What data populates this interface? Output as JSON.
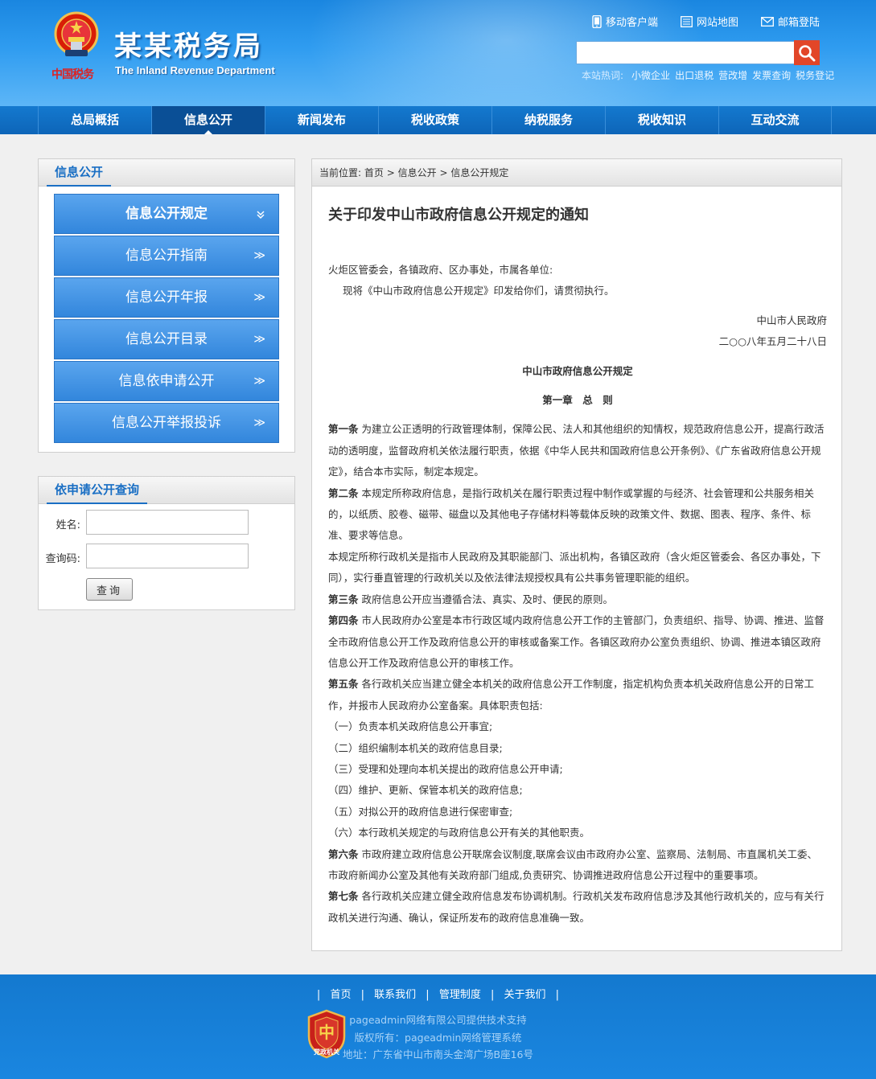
{
  "header": {
    "emblem_text": "中国税务",
    "title": "某某税务局",
    "subtitle": "The Inland Revenue Department",
    "top_links": [
      {
        "icon": "mobile-icon",
        "label": "移动客户端"
      },
      {
        "icon": "sitemap-icon",
        "label": "网站地图"
      },
      {
        "icon": "mail-icon",
        "label": "邮箱登陆"
      }
    ],
    "search": {
      "placeholder": "",
      "value": ""
    },
    "hot_label": "本站热词:",
    "hot_words": [
      "小微企业",
      "出口退税",
      "营改增",
      "发票查询",
      "税务登记"
    ]
  },
  "nav": {
    "items": [
      "总局概括",
      "信息公开",
      "新闻发布",
      "税收政策",
      "纳税服务",
      "税收知识",
      "互动交流"
    ],
    "active": 1
  },
  "sidebar": {
    "menu_title": "信息公开",
    "menu_items": [
      {
        "label": "信息公开规定",
        "chev": "≫",
        "active": true
      },
      {
        "label": "信息公开指南",
        "chev": "≫"
      },
      {
        "label": "信息公开年报",
        "chev": "≫"
      },
      {
        "label": "信息公开目录",
        "chev": "≫"
      },
      {
        "label": "信息依申请公开",
        "chev": "≫"
      },
      {
        "label": "信息公开举报投诉",
        "chev": "≫"
      }
    ],
    "query_title": "依申请公开查询",
    "name_label": "姓名:",
    "code_label": "查询码:",
    "query_button": "查询"
  },
  "main": {
    "crumb_label": "当前位置:",
    "crumbs": [
      "首页",
      "信息公开",
      "信息公开规定"
    ],
    "crumb_sep": ">",
    "title": "关于印发中山市政府信息公开规定的通知",
    "addressee": "火炬区管委会，各镇政府、区办事处，市属各单位:",
    "intro": "现将《中山市政府信息公开规定》印发给你们，请贯彻执行。",
    "signer": "中山市人民政府",
    "date": "二○○八年五月二十八日",
    "doc_title": "中山市政府信息公开规定",
    "chapter": "第一章　总　则",
    "articles": [
      {
        "head": "第一条",
        "text": "为建立公正透明的行政管理体制，保障公民、法人和其他组织的知情权，规范政府信息公开，提高行政活动的透明度，监督政府机关依法履行职责，依据《中华人民共和国政府信息公开条例》、《广东省政府信息公开规定》，结合本市实际，制定本规定。"
      },
      {
        "head": "第二条",
        "text": "本规定所称政府信息，是指行政机关在履行职责过程中制作或掌握的与经济、社会管理和公共服务相关的，以纸质、胶卷、磁带、磁盘以及其他电子存储材料等载体反映的政策文件、数据、图表、程序、条件、标准、要求等信息。"
      },
      {
        "head": "",
        "text": "本规定所称行政机关是指市人民政府及其职能部门、派出机构，各镇区政府（含火炬区管委会、各区办事处，下同），实行垂直管理的行政机关以及依法律法规授权具有公共事务管理职能的组织。"
      },
      {
        "head": "第三条",
        "text": "政府信息公开应当遵循合法、真实、及时、便民的原则。"
      },
      {
        "head": "第四条",
        "text": "市人民政府办公室是本市行政区域内政府信息公开工作的主管部门，负责组织、指导、协调、推进、监督全市政府信息公开工作及政府信息公开的审核或备案工作。各镇区政府办公室负责组织、协调、推进本镇区政府信息公开工作及政府信息公开的审核工作。"
      },
      {
        "head": "第五条",
        "text": "各行政机关应当建立健全本机关的政府信息公开工作制度，指定机构负责本机关政府信息公开的日常工作，并报市人民政府办公室备案。具体职责包括:"
      },
      {
        "head": "",
        "text": "（一）负责本机关政府信息公开事宜;"
      },
      {
        "head": "",
        "text": "（二）组织编制本机关的政府信息目录;"
      },
      {
        "head": "",
        "text": "（三）受理和处理向本机关提出的政府信息公开申请;"
      },
      {
        "head": "",
        "text": "（四）维护、更新、保管本机关的政府信息;"
      },
      {
        "head": "",
        "text": "（五）对拟公开的政府信息进行保密审查;"
      },
      {
        "head": "",
        "text": "（六）本行政机关规定的与政府信息公开有关的其他职责。"
      },
      {
        "head": "第六条",
        "text": "市政府建立政府信息公开联席会议制度,联席会议由市政府办公室、监察局、法制局、市直属机关工委、市政府新闻办公室及其他有关政府部门组成,负责研究、协调推进政府信息公开过程中的重要事项。"
      },
      {
        "head": "第七条",
        "text": "各行政机关应建立健全政府信息发布协调机制。行政机关发布政府信息涉及其他行政机关的，应与有关行政机关进行沟通、确认，保证所发布的政府信息准确一致。"
      }
    ]
  },
  "footer": {
    "links": [
      "首页",
      "联系我们",
      "管理制度",
      "关于我们"
    ],
    "link_sep": "|",
    "badge_text": "党政机关",
    "support": "pageadmin网络有限公司提供技术支持",
    "copyright": "版权所有：pageadmin网络管理系统",
    "address": "地址：广东省中山市南头金湾广场B座16号"
  },
  "colors": {
    "header_blue": "#2f9cf0",
    "nav_blue": "#0d65b8",
    "active_nav": "#0a4f96",
    "menu_blue": "#3286dc",
    "search_red": "#e24628",
    "title_blue": "#1a6fc4"
  }
}
